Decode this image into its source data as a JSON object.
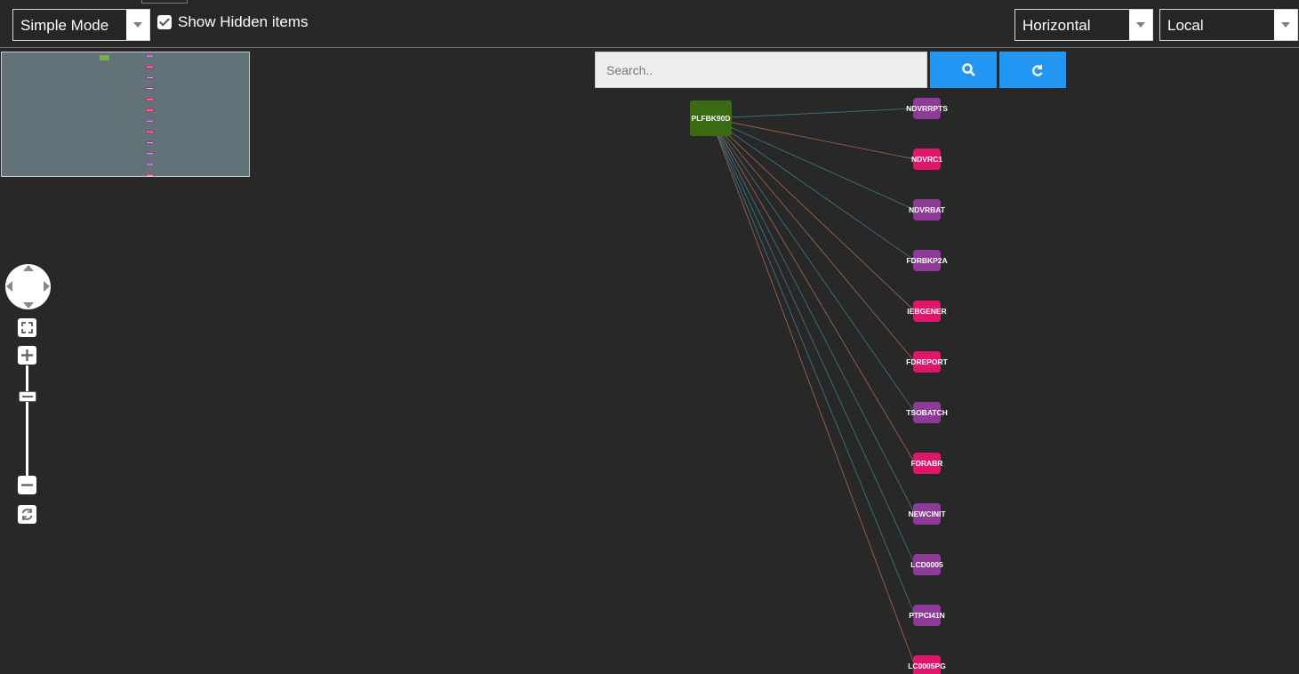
{
  "toolbar": {
    "mode_select": {
      "value": "Simple Mode"
    },
    "show_hidden": {
      "label": "Show Hidden items",
      "checked": true
    },
    "orientation_select": {
      "value": "Horizontal"
    },
    "scope_select": {
      "value": "Local"
    }
  },
  "search": {
    "placeholder": "Search..",
    "search_icon": "search-icon",
    "refresh_icon": "refresh-icon"
  },
  "graph": {
    "root": {
      "label": "PLFBK90D",
      "color": "#3a6b13"
    },
    "edge_colors": {
      "blue": "#3f7f94",
      "orange": "#b06a52"
    },
    "nodes": [
      {
        "label": "NDVRRPTS",
        "color": "#8e3a99",
        "edge": "blue"
      },
      {
        "label": "NDVRC1",
        "color": "#e0166a",
        "edge": "orange"
      },
      {
        "label": "NDVRBAT",
        "color": "#8e3a99",
        "edge": "blue"
      },
      {
        "label": "FDRBKP2A",
        "color": "#8e3a99",
        "edge": "blue"
      },
      {
        "label": "IEBGENER",
        "color": "#e0166a",
        "edge": "orange"
      },
      {
        "label": "FDREPORT",
        "color": "#e0166a",
        "edge": "orange"
      },
      {
        "label": "TSOBATCH",
        "color": "#8e3a99",
        "edge": "blue"
      },
      {
        "label": "FDRABR",
        "color": "#e0166a",
        "edge": "orange"
      },
      {
        "label": "NEWCINIT",
        "color": "#8e3a99",
        "edge": "blue"
      },
      {
        "label": "LCD0005",
        "color": "#8e3a99",
        "edge": "blue"
      },
      {
        "label": "PTPCI41N",
        "color": "#8e3a99",
        "edge": "blue"
      },
      {
        "label": "LC0005PG",
        "color": "#e0166a",
        "edge": "orange"
      }
    ]
  },
  "minimap": {
    "background": "#617378"
  },
  "navigation": {
    "pan_control": "pan-arrows",
    "fit_icon": "fit-to-screen-icon",
    "zoom_in_icon": "plus-icon",
    "zoom_out_icon": "minus-icon",
    "reset_icon": "reset-icon"
  }
}
